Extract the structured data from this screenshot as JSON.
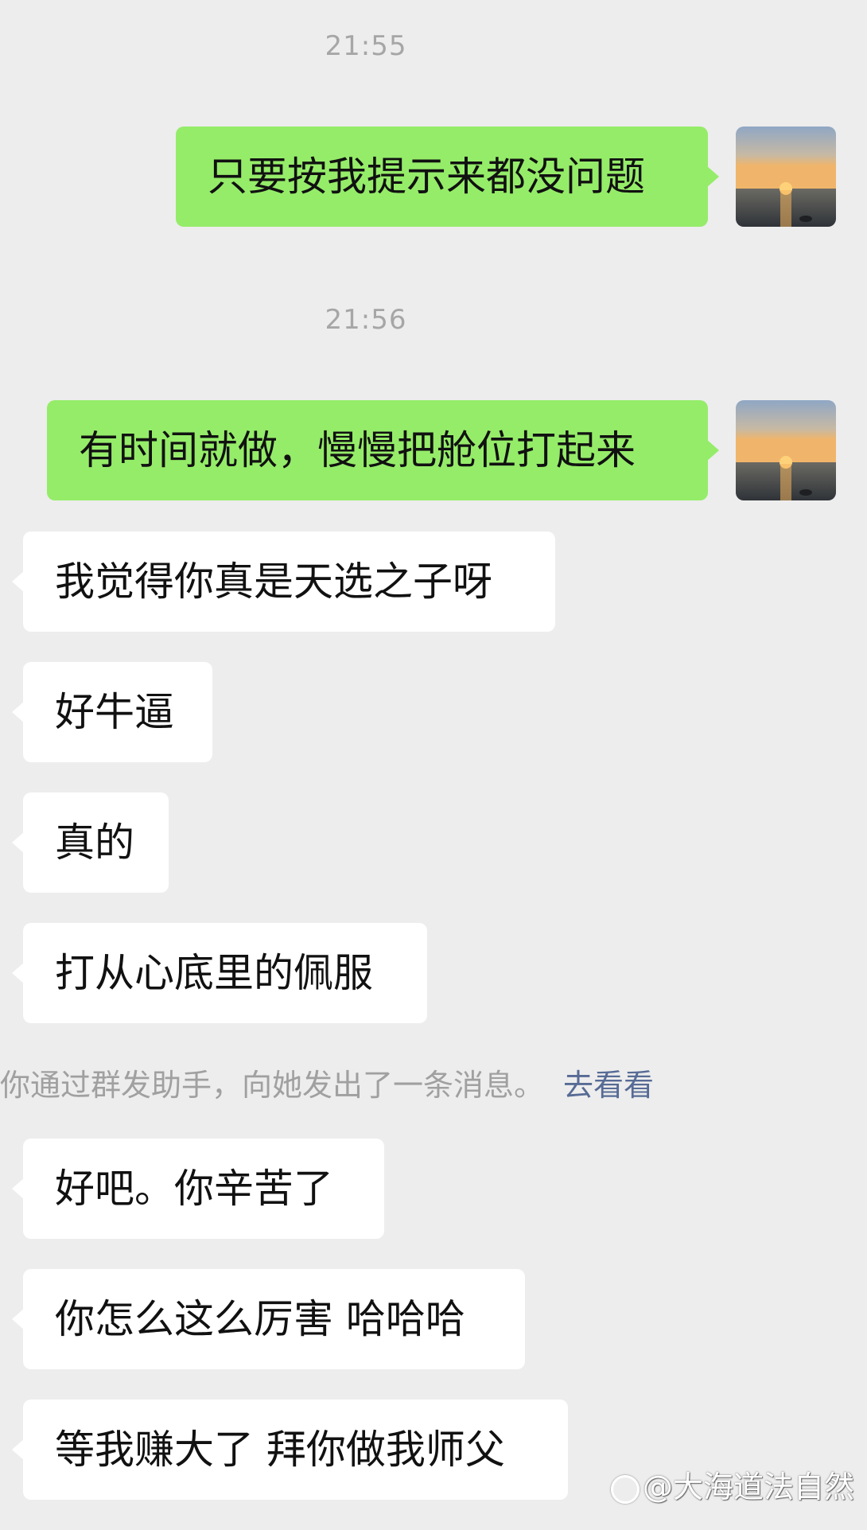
{
  "timestamps": [
    "21:55",
    "21:56"
  ],
  "messages_sent": [
    "只要按我提示来都没问题",
    "有时间就做，慢慢把舱位打起来"
  ],
  "messages_received_1": [
    "我觉得你真是天选之子呀",
    "好牛逼",
    "真的",
    "打从心底里的佩服"
  ],
  "system_notice": {
    "text": "你通过群发助手，向她发出了一条消息。",
    "link": "去看看"
  },
  "messages_received_2": [
    "好吧。你辛苦了",
    "你怎么这么厉害 哈哈哈",
    "等我赚大了 拜你做我师父"
  ],
  "watermark": "@大海道法自然",
  "colors": {
    "background": "#ededed",
    "sent_bubble": "#95ec69",
    "received_bubble": "#ffffff",
    "link": "#576b95",
    "timestamp": "#a6a6a6"
  },
  "icons": {
    "avatar": "sunset-over-sea-avatar",
    "watermark_logo": "platform-logo-icon"
  }
}
